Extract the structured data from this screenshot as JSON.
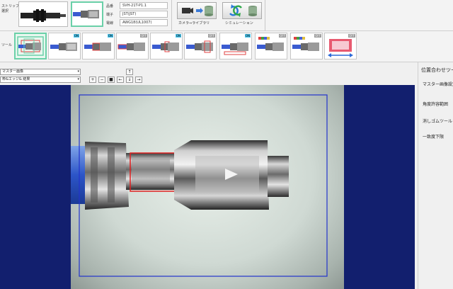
{
  "header": {
    "strip_label_line1": "ストリップ/クリンプ",
    "strip_label_line2": "選択",
    "info": [
      {
        "key": "品番",
        "value": "SVH-21T-P1.1"
      },
      {
        "key": "端子",
        "value": "JST(JST)"
      },
      {
        "key": "電線",
        "value": "AWG18(UL1007)"
      }
    ],
    "camera_library_label": "カメラ⇒ライブラリ",
    "simulation_label": "シミュレーション"
  },
  "tools": {
    "label": "ツール",
    "items": [
      {
        "state": ""
      },
      {
        "state": "ON"
      },
      {
        "state": "ON"
      },
      {
        "state": "OFF"
      },
      {
        "state": "ON"
      },
      {
        "state": "OFF"
      },
      {
        "state": "ON"
      },
      {
        "state": "OFF"
      },
      {
        "state": "OFF"
      },
      {
        "state": "OFF"
      }
    ]
  },
  "controls": {
    "image_select": "マスター画像",
    "overlay_select": "枠&エッジ& 結果",
    "up": "↑",
    "down": "↓",
    "left": "←",
    "right": "→",
    "plus": "+",
    "minus": "−",
    "stop": "■"
  },
  "panel": {
    "title": "位置合わせツール",
    "items": [
      "マスター画像設定",
      "角度許容範囲",
      "消しゴムツール",
      "一致度下限"
    ]
  },
  "colors": {
    "view_background": "#121f6e",
    "roi_blue": "#2233cc",
    "roi_red": "#e02020",
    "badge_on": "#4ec8f0",
    "badge_off": "#9a9a9a",
    "selection_green": "#6ad0a8"
  }
}
